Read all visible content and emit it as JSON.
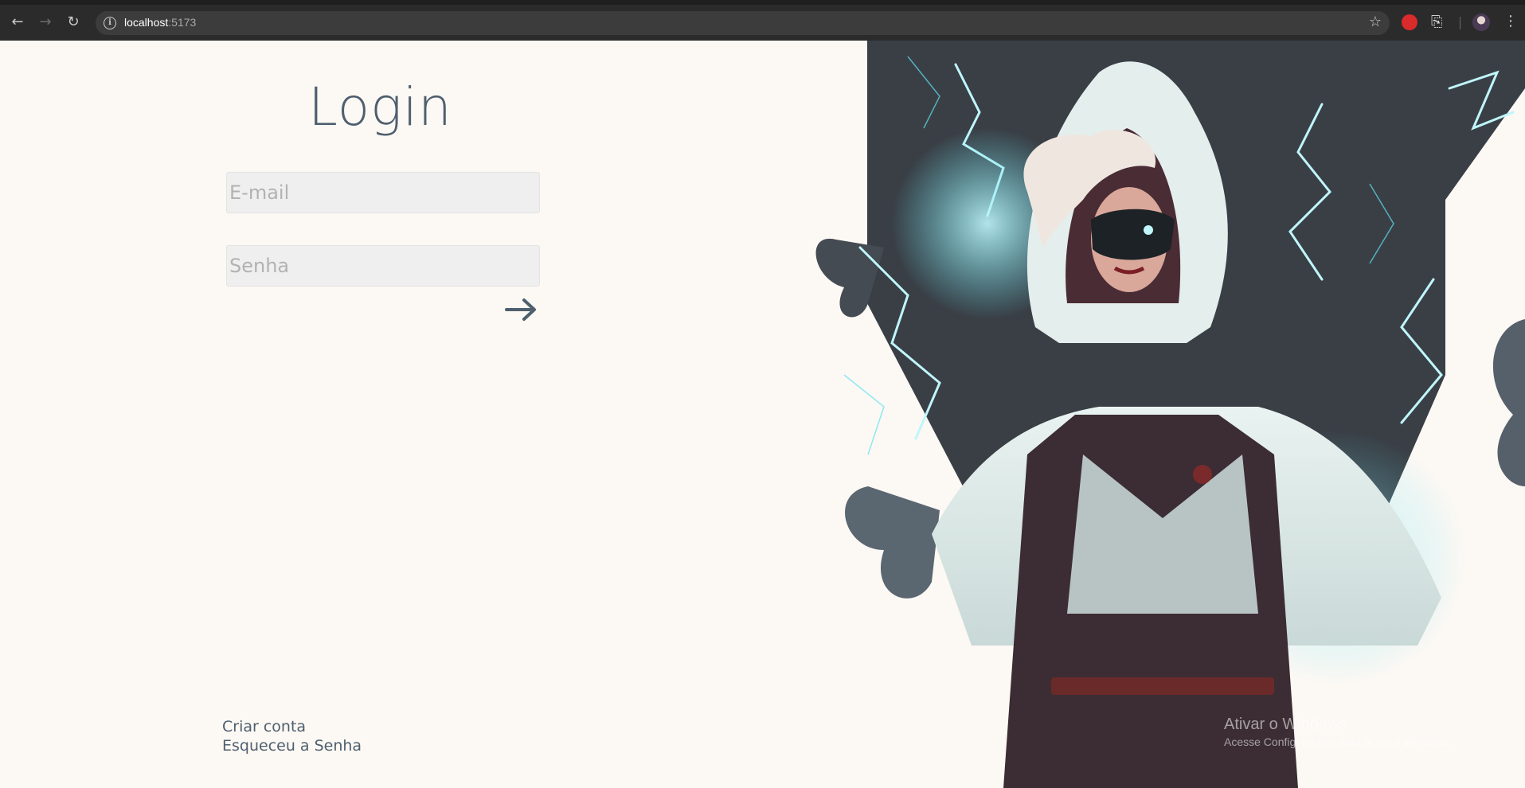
{
  "browser": {
    "url_host": "localhost",
    "url_port": ":5173",
    "icons": [
      "back-icon",
      "forward-icon",
      "reload-icon",
      "info-icon",
      "star-icon",
      "extension-icon",
      "puzzle-icon",
      "profile-avatar",
      "menu-icon"
    ]
  },
  "login": {
    "title": "Login",
    "email_placeholder": "E-mail",
    "password_placeholder": "Senha",
    "submit_icon": "arrow-right-icon"
  },
  "links": {
    "create_account": "Criar conta",
    "forgot_password": "Esqueceu a Senha"
  },
  "watermark": {
    "line1": "Ativar o Windows",
    "line2": "Acesse Configurações para ativar o Windows."
  },
  "colors": {
    "page_bg": "#fcf8f4",
    "text_primary": "#4e5f6e",
    "input_bg": "#efefef",
    "art_dark": "#3a3f46",
    "art_glow": "#5fe3f0"
  }
}
